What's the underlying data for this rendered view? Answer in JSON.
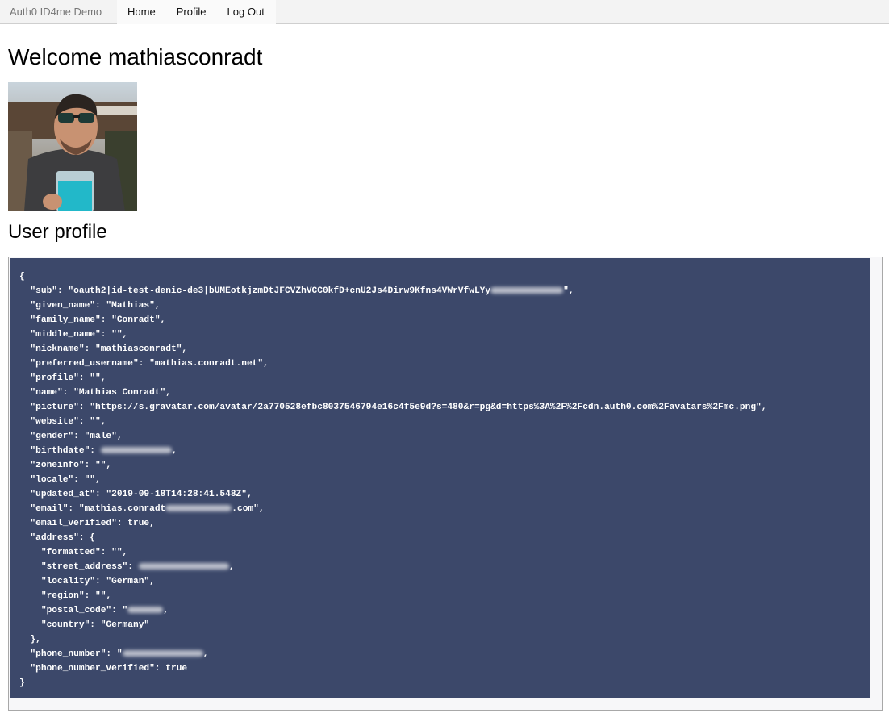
{
  "navbar": {
    "brand": "Auth0 ID4me Demo",
    "links": [
      "Home",
      "Profile",
      "Log Out"
    ]
  },
  "welcome_title": "Welcome mathiasconradt",
  "profile_heading": "User profile",
  "json_lines": {
    "l00": "{",
    "l01": "  \"sub\": \"oauth2|id-test-denic-de3|bUMEotkjzmDtJFCVZhVCC0kfD+cnU2Js4Dirw9Kfns4VWrVfwLYy",
    "l01b": "\",",
    "l02": "  \"given_name\": \"Mathias\",",
    "l03": "  \"family_name\": \"Conradt\",",
    "l04": "  \"middle_name\": \"\",",
    "l05": "  \"nickname\": \"mathiasconradt\",",
    "l06": "  \"preferred_username\": \"mathias.conradt.net\",",
    "l07": "  \"profile\": \"\",",
    "l08": "  \"name\": \"Mathias Conradt\",",
    "l09": "  \"picture\": \"https://s.gravatar.com/avatar/2a770528efbc8037546794e16c4f5e9d?s=480&r=pg&d=https%3A%2F%2Fcdn.auth0.com%2Favatars%2Fmc.png\",",
    "l10": "  \"website\": \"\",",
    "l11": "  \"gender\": \"male\",",
    "l12": "  \"birthdate\": ",
    "l12b": ",",
    "l13": "  \"zoneinfo\": \"\",",
    "l14": "  \"locale\": \"\",",
    "l15": "  \"updated_at\": \"2019-09-18T14:28:41.548Z\",",
    "l16": "  \"email\": \"mathias.conradt",
    "l16b": ".com\",",
    "l17": "  \"email_verified\": true,",
    "l18": "  \"address\": {",
    "l19": "    \"formatted\": \"\",",
    "l20": "    \"street_address\": ",
    "l20b": ",",
    "l21": "    \"locality\": \"German\",",
    "l22": "    \"region\": \"\",",
    "l23": "    \"postal_code\": \"",
    "l23b": ",",
    "l24": "    \"country\": \"Germany\"",
    "l25": "  },",
    "l26": "  \"phone_number\": \"",
    "l26b": ",",
    "l27": "  \"phone_number_verified\": true",
    "l28": "}"
  },
  "icons": {
    "avatar": "profile-photo"
  },
  "colors": {
    "code_background": "#3c486a",
    "navbar_background": "#f3f3f3"
  }
}
